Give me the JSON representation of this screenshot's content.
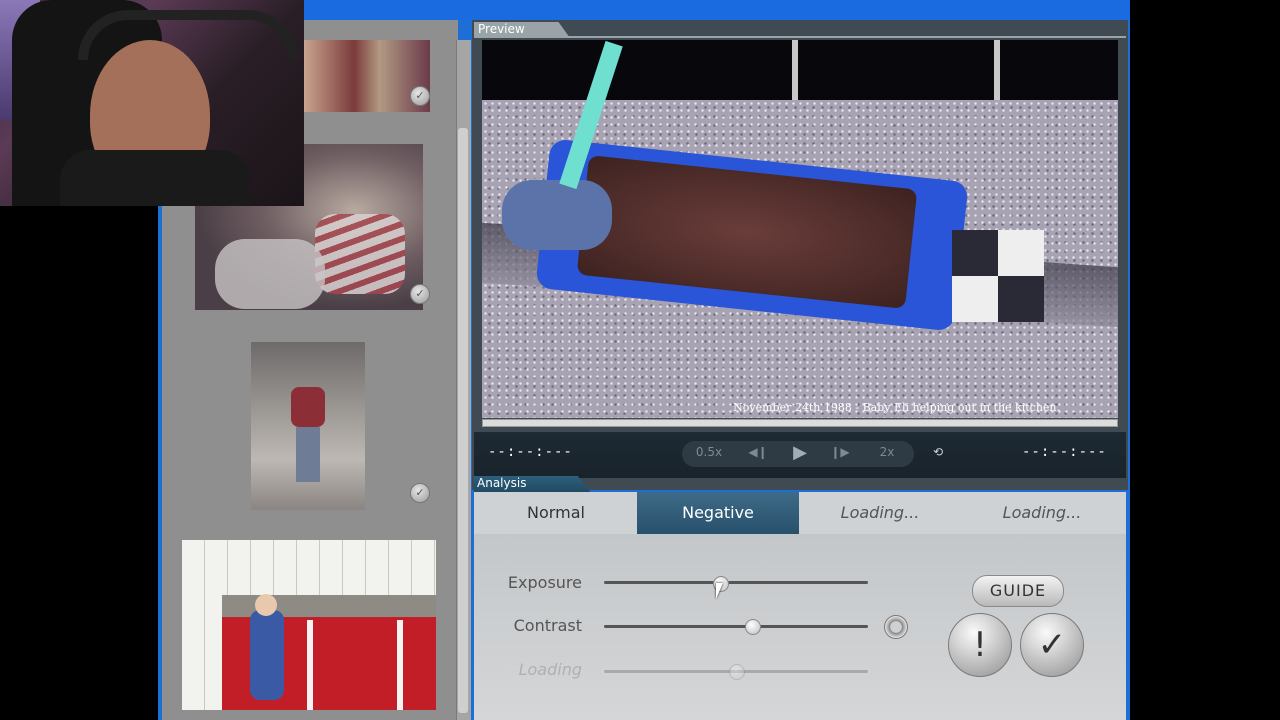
{
  "preview": {
    "label": "Preview",
    "caption": "November 24th 1988 - Baby Eli helping out in the kitchen.",
    "time_left": "--:--:---",
    "time_right": "--:--:---",
    "speed_slow": "0.5x",
    "speed_fast": "2x"
  },
  "analysis": {
    "label": "Analysis",
    "tabs": [
      {
        "label": "Normal",
        "active": false
      },
      {
        "label": "Negative",
        "active": true
      },
      {
        "label": "Loading...",
        "active": false
      },
      {
        "label": "Loading...",
        "active": false
      }
    ],
    "sliders": [
      {
        "label": "Exposure",
        "value": 0.44
      },
      {
        "label": "Contrast",
        "value": 0.56
      },
      {
        "label": "Loading",
        "value": 0.5
      }
    ],
    "guide_label": "GUIDE",
    "alert_label": "!",
    "confirm_label": "✓"
  },
  "icons": [
    "play-icon",
    "step-back-icon",
    "step-forward-icon",
    "loop-icon",
    "check-icon",
    "cursor-icon"
  ]
}
